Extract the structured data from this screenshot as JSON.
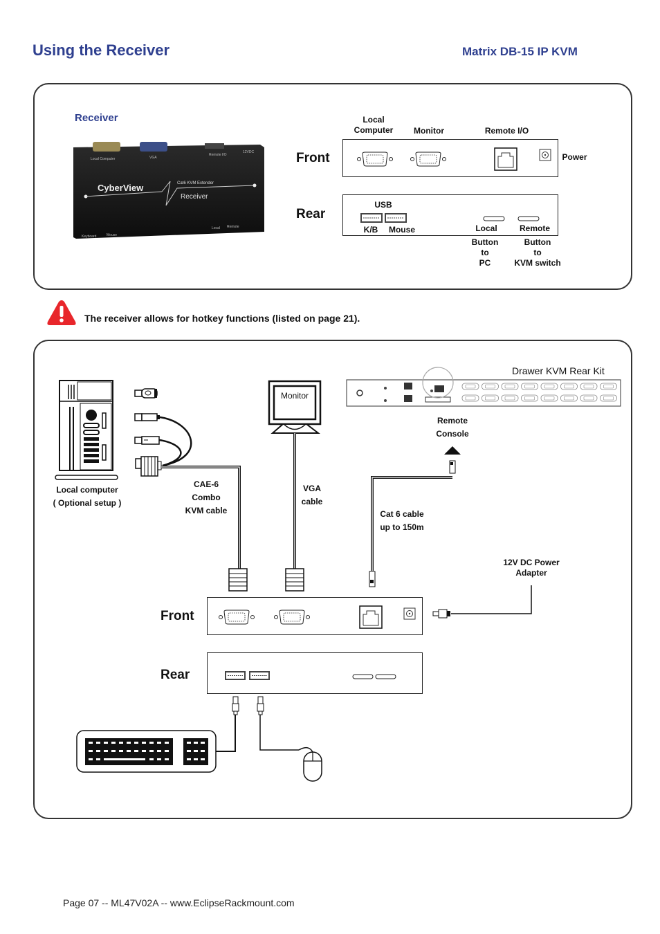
{
  "header": {
    "title": "Using the Receiver",
    "product": "Matrix  DB-15 IP KVM"
  },
  "colors": {
    "accent_blue": "#2e3f8f",
    "warning_red": "#e8262b",
    "line_black": "#111111"
  },
  "receiver_panel": {
    "photo_label": "Receiver",
    "photo_caption": {
      "brand": "CyberView",
      "product_line": "Cat6 KVM Extender",
      "product": "Receiver"
    },
    "front": {
      "label": "Front",
      "ports": [
        "Local Computer",
        "Monitor",
        "Remote I/O"
      ],
      "port_local_line1": "Local",
      "port_local_line2": "Computer",
      "port_monitor": "Monitor",
      "port_remote_io": "Remote I/O",
      "power": "Power"
    },
    "rear": {
      "label": "Rear",
      "usb": "USB",
      "kb": "K/B",
      "mouse": "Mouse",
      "local": "Local",
      "remote": "Remote",
      "local_desc": [
        "Button",
        "to",
        "PC"
      ],
      "remote_desc": [
        "Button",
        "to",
        "KVM switch"
      ]
    }
  },
  "warning": {
    "icon": "warning-triangle-icon",
    "text": "The receiver allows for hotkey functions (listed on page 21)."
  },
  "connection_diagram": {
    "drawer_kit_label": "Drawer KVM Rear Kit",
    "remote_console": [
      "Remote",
      "Console"
    ],
    "local_computer": [
      "Local computer",
      "( Optional setup )"
    ],
    "combo_cable": [
      "CAE-6",
      "Combo",
      "KVM cable"
    ],
    "monitor_label": "Monitor",
    "vga_cable": [
      "VGA",
      "cable"
    ],
    "cat6_cable": [
      "Cat 6 cable",
      "up to 150m"
    ],
    "power_adapter": [
      "12V DC Power",
      "Adapter"
    ],
    "front_label": "Front",
    "rear_label": "Rear"
  },
  "footer": {
    "text": "Page 07 -- ML47V02A -- www.EclipseRackmount.com"
  }
}
